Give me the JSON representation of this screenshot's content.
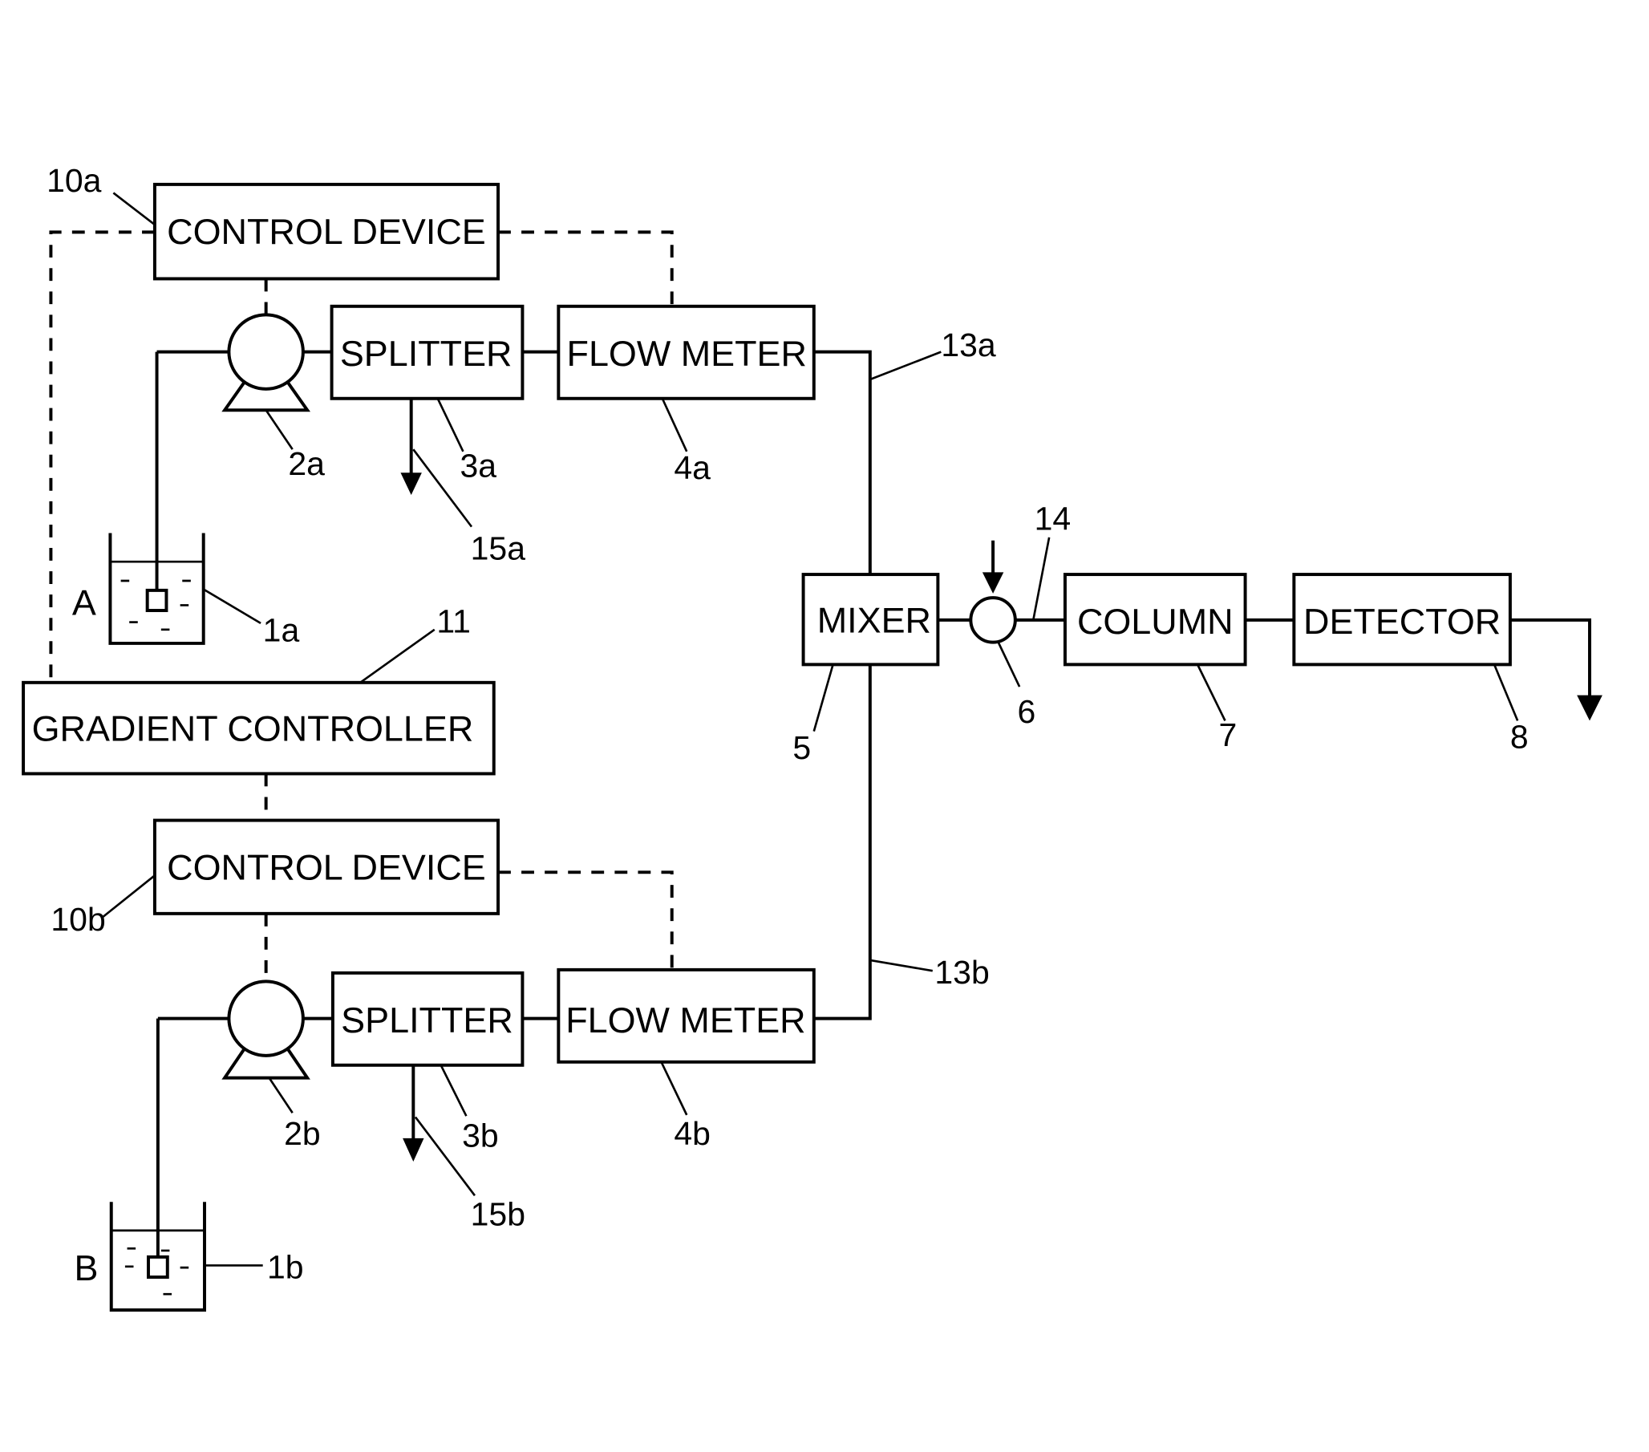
{
  "diagram": {
    "type": "liquid chromatography gradient system block diagram",
    "colors": {
      "ink": "#000000",
      "background": "#ffffff"
    },
    "blocks": {
      "control_device_a": "CONTROL DEVICE",
      "control_device_b": "CONTROL DEVICE",
      "splitter_a": "SPLITTER",
      "splitter_b": "SPLITTER",
      "flow_meter_a": "FLOW METER",
      "flow_meter_b": "FLOW METER",
      "gradient_controller": "GRADIENT CONTROLLER",
      "mixer": "MIXER",
      "column": "COLUMN",
      "detector": "DETECTOR"
    },
    "tank_labels": {
      "a": "A",
      "b": "B"
    },
    "reference_numerals": {
      "control_device_a": "10a",
      "control_device_b": "10b",
      "pump_a": "2a",
      "pump_b": "2b",
      "splitter_a": "3a",
      "splitter_b": "3b",
      "flow_meter_a": "4a",
      "flow_meter_b": "4b",
      "drain_a": "15a",
      "drain_b": "15b",
      "tank_a": "1a",
      "tank_b": "1b",
      "gradient_controller": "11",
      "line_a": "13a",
      "line_b": "13b",
      "mixer": "5",
      "injector": "6",
      "line_14": "14",
      "column": "7",
      "detector": "8"
    }
  }
}
